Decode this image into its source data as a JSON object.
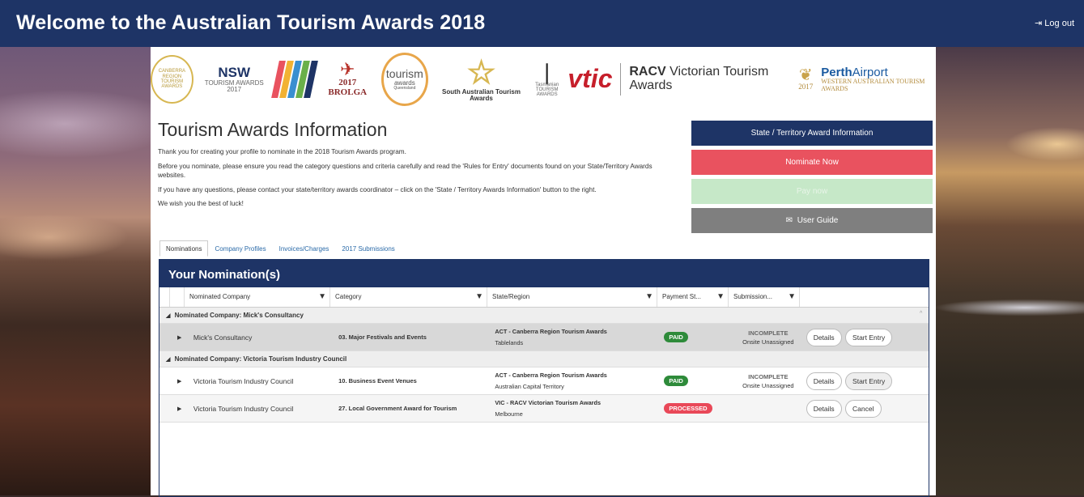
{
  "header": {
    "title": "Welcome to the Australian Tourism Awards 2018",
    "logout": "Log out",
    "logout_icon": "sign-out-icon"
  },
  "logos": {
    "canberra": "CANBERRA REGION TOURISM AWARDS",
    "nsw_title": "NSW",
    "nsw_sub": "TOURISM AWARDS 2017",
    "brolga": "2017 BROLGA",
    "tourism_title": "tourism",
    "tourism_sub": "awards",
    "queensland": "Queensland",
    "sa": "South Australian Tourism Awards",
    "tasmania": "Tasmanian TOURISM AWARDS",
    "vtic": "vtic",
    "racv_brand": "RACV",
    "racv_rest": " Victorian Tourism Awards",
    "wa_year": "2017",
    "perth_brand": "Perth",
    "perth_rest": "Airport",
    "wa_name": "WESTERN AUSTRALIAN TOURISM AWARDS"
  },
  "info": {
    "title": "Tourism Awards Information",
    "p1": "Thank you for creating your profile to nominate in the 2018 Tourism Awards program.",
    "p2": "Before you nominate, please ensure you read the category questions and criteria carefully and read the 'Rules for Entry' documents found on your State/Territory Awards websites.",
    "p3": "If you have any questions, please contact your state/territory awards coordinator – click on the 'State / Territory Awards Information' button to the right.",
    "p4": "We wish you the best of luck!"
  },
  "buttons": {
    "state_info": "State / Territory Award Information",
    "nominate": "Nominate Now",
    "disabled": "Pay now",
    "user_guide": "User Guide"
  },
  "tabs": [
    "Nominations",
    "Company Profiles",
    "Invoices/Charges",
    "2017 Submissions"
  ],
  "grid": {
    "title": "Your Nomination(s)",
    "columns": {
      "company": "Nominated Company",
      "category": "Category",
      "state": "State/Region",
      "payment": "Payment St...",
      "submission": "Submission..."
    },
    "groups": [
      {
        "label": "Nominated Company: Mick's Consultancy"
      },
      {
        "label": "Nominated Company: Victoria Tourism Industry Council"
      }
    ],
    "rows": [
      {
        "company": "Mick's Consultancy",
        "category": "03. Major Festivals and Events",
        "award": "ACT - Canberra Region Tourism Awards",
        "region": "Tablelands",
        "payment": "PAID",
        "status": "INCOMPLETE",
        "status_sub": "Onsite Unassigned",
        "btn1": "Details",
        "btn2": "Start Entry"
      },
      {
        "company": "Victoria Tourism Industry Council",
        "category": "10. Business Event Venues",
        "award": "ACT - Canberra Region Tourism Awards",
        "region": "Australian Capital Territory",
        "payment": "PAID",
        "status": "INCOMPLETE",
        "status_sub": "Onsite Unassigned",
        "btn1": "Details",
        "btn2": "Start Entry"
      },
      {
        "company": "Victoria Tourism Industry Council",
        "category": "27. Local Government Award for Tourism",
        "award": "VIC - RACV Victorian Tourism Awards",
        "region": "Melbourne",
        "payment": "PROCESSED",
        "status": "",
        "status_sub": "",
        "btn1": "Details",
        "btn2": "Cancel"
      }
    ]
  },
  "colors": {
    "navy": "#1e3466",
    "red": "#e9525f",
    "green_disabled": "#c6e8c8",
    "gray": "#7f7f7f",
    "paid": "#2e8b3a",
    "processed": "#e94858"
  }
}
